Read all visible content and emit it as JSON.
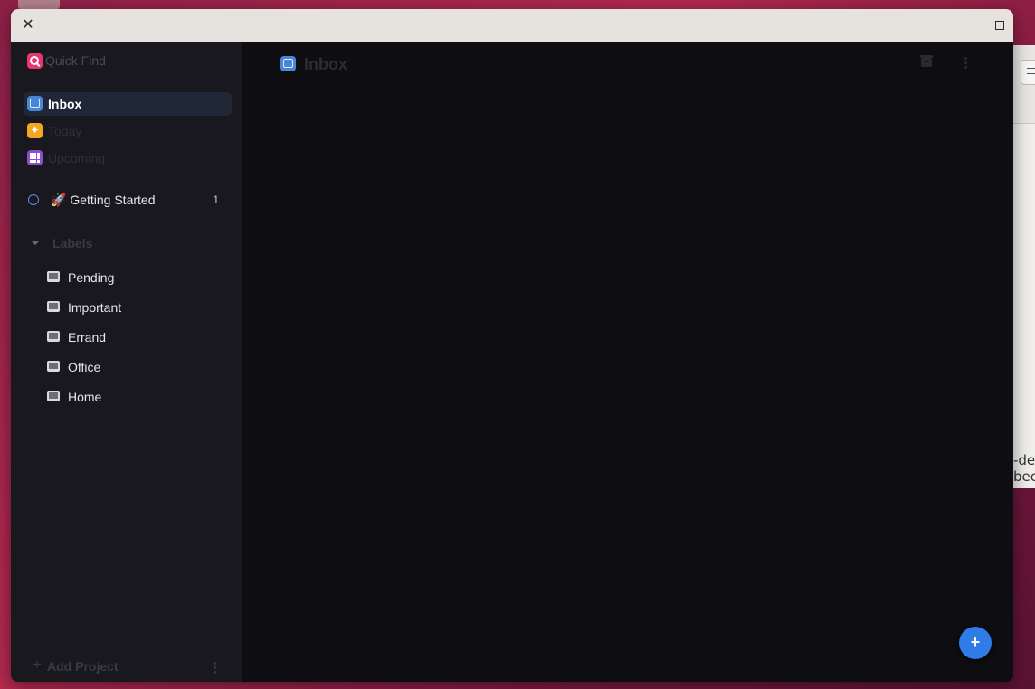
{
  "window": {
    "close_glyph": "✕",
    "max_glyph": ""
  },
  "sidebar": {
    "search": {
      "label": "Quick Find",
      "icon": "search-icon"
    },
    "nav": [
      {
        "label": "Inbox",
        "icon": "inbox-icon",
        "active": true
      },
      {
        "label": "Today",
        "icon": "today-star-icon",
        "active": false
      },
      {
        "label": "Upcoming",
        "icon": "calendar-icon",
        "active": false
      }
    ],
    "project": {
      "label": "🚀 Getting Started",
      "count": "1",
      "color": "#5b8de8"
    },
    "labels_section": {
      "title": "Labels",
      "items": [
        "Pending",
        "Important",
        "Errand",
        "Office",
        "Home"
      ]
    },
    "add_project": {
      "plus": "+",
      "label": "Add Project"
    }
  },
  "main": {
    "title": "Inbox",
    "fab_glyph": "+"
  },
  "background": {
    "window_text_line1": "-de",
    "window_text_line2": "bec"
  },
  "colors": {
    "accent": "#2f7be8",
    "inbox": "#4a86d8",
    "today": "#f5a623",
    "upcoming": "#8a4fd6",
    "search": "#e8366f"
  }
}
